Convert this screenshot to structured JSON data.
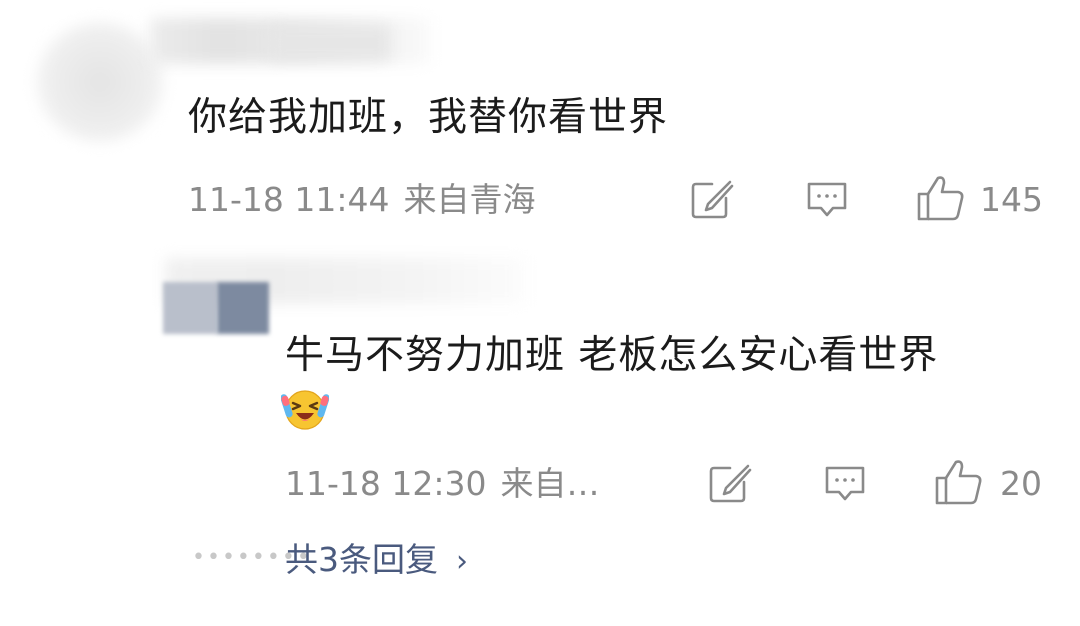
{
  "comment": {
    "text": "你给我加班，我替你看世界",
    "time": "11-18 11:44",
    "location": "来自青海",
    "like_count": "145"
  },
  "reply": {
    "text": "牛马不努力加班 老板怎么安心看世界",
    "emoji_icon": "crying-laughing-emoji",
    "time": "11-18 12:30",
    "location": "来自…",
    "like_count": "20"
  },
  "replies_summary": {
    "label": "共3条回复",
    "chevron": "›"
  },
  "icons": {
    "repost": "repost-icon",
    "comment": "comment-icon",
    "like": "thumbs-up-icon"
  }
}
